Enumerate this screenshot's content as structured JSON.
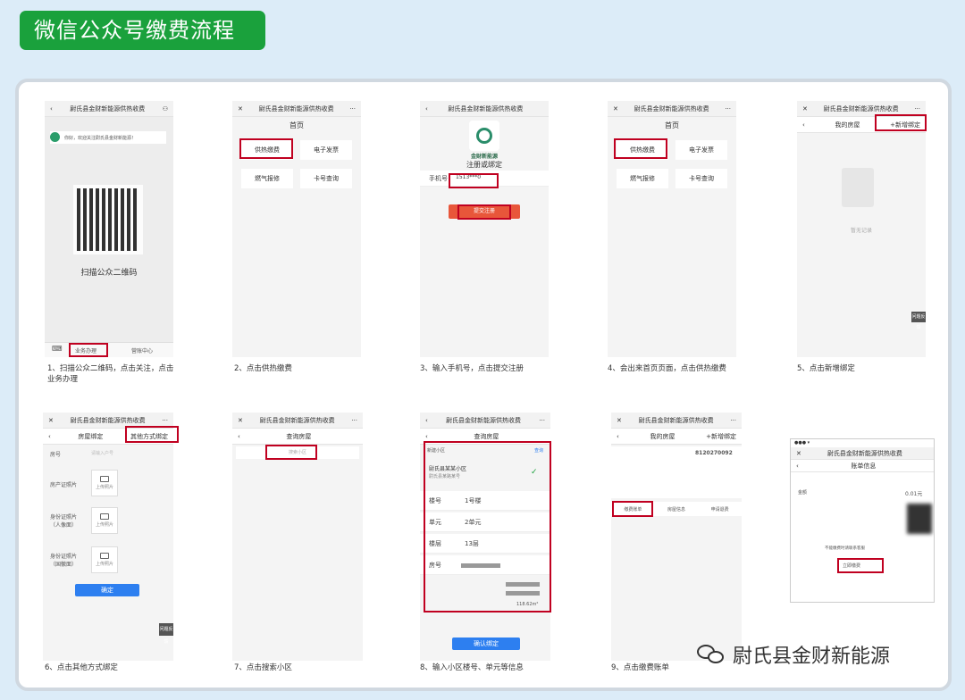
{
  "title": "微信公众号缴费流程",
  "app_name": "尉氏县金财新能源供热收费",
  "watermark": "尉氏县金财新能源",
  "steps": [
    {
      "caption": "1、扫描公众二维码，点击关注，点击业务办理",
      "chat": "你好，欢迎关注尉氏县金财新能源！",
      "qr_label": "扫描公众二维码",
      "tab1": "业务办理",
      "tab2": "营账中心"
    },
    {
      "caption": "2、点击供热缴费",
      "home": "首页",
      "tiles": [
        "供热缴费",
        "电子发票",
        "燃气报修",
        "卡号查询"
      ]
    },
    {
      "caption": "3、输入手机号，点击提交注册",
      "brand": "金财新能源",
      "heading": "注册或绑定",
      "field_label": "手机号",
      "field_value": "1513***0",
      "submit": "提交注册"
    },
    {
      "caption": "4、会出来首页页面，点击供热缴费",
      "home": "首页",
      "tiles": [
        "供热缴费",
        "电子发票",
        "燃气报修",
        "卡号查询"
      ]
    },
    {
      "caption": "5、点击新增绑定",
      "page": "我的房屋",
      "add": "+新增绑定",
      "empty": "暂无记录",
      "help": "问题反馈"
    },
    {
      "caption": "6、点击其他方式绑定",
      "page": "房屋绑定",
      "other": "其他方式绑定",
      "f1": "房号",
      "f1_ph": "请输入户号",
      "f2": "房产证照片",
      "f3": "身份证照片（人像面）",
      "f4": "身份证照片（国徽面）",
      "upload": "上传照片",
      "confirm": "确定"
    },
    {
      "caption": "7、点击搜索小区",
      "page": "查询房屋",
      "search": "搜索小区"
    },
    {
      "caption": "8、输入小区楼号、单元等信息",
      "page": "查询房屋",
      "search_val": "新建小区",
      "search_btn": "查询",
      "community": "尉氏县某某小区",
      "community_sub": "尉氏县某路某号",
      "rows": [
        "楼号",
        "单元",
        "楼层",
        "房号"
      ],
      "vals": [
        "1号楼",
        "2单元",
        "13层",
        ""
      ],
      "area": "118.62m²",
      "bind": "确认绑定"
    },
    {
      "caption": "9、点击缴费账单",
      "page": "我的房屋",
      "add": "+新增绑定",
      "account": "8120270092",
      "tabs": [
        "缴费账单",
        "房屋信息",
        "申请退费"
      ]
    },
    {
      "page": "账单信息",
      "amount_label": "金额",
      "amount": "0.01元",
      "pay": "立即缴费",
      "remark": "不能缴费时请联系客服"
    }
  ]
}
